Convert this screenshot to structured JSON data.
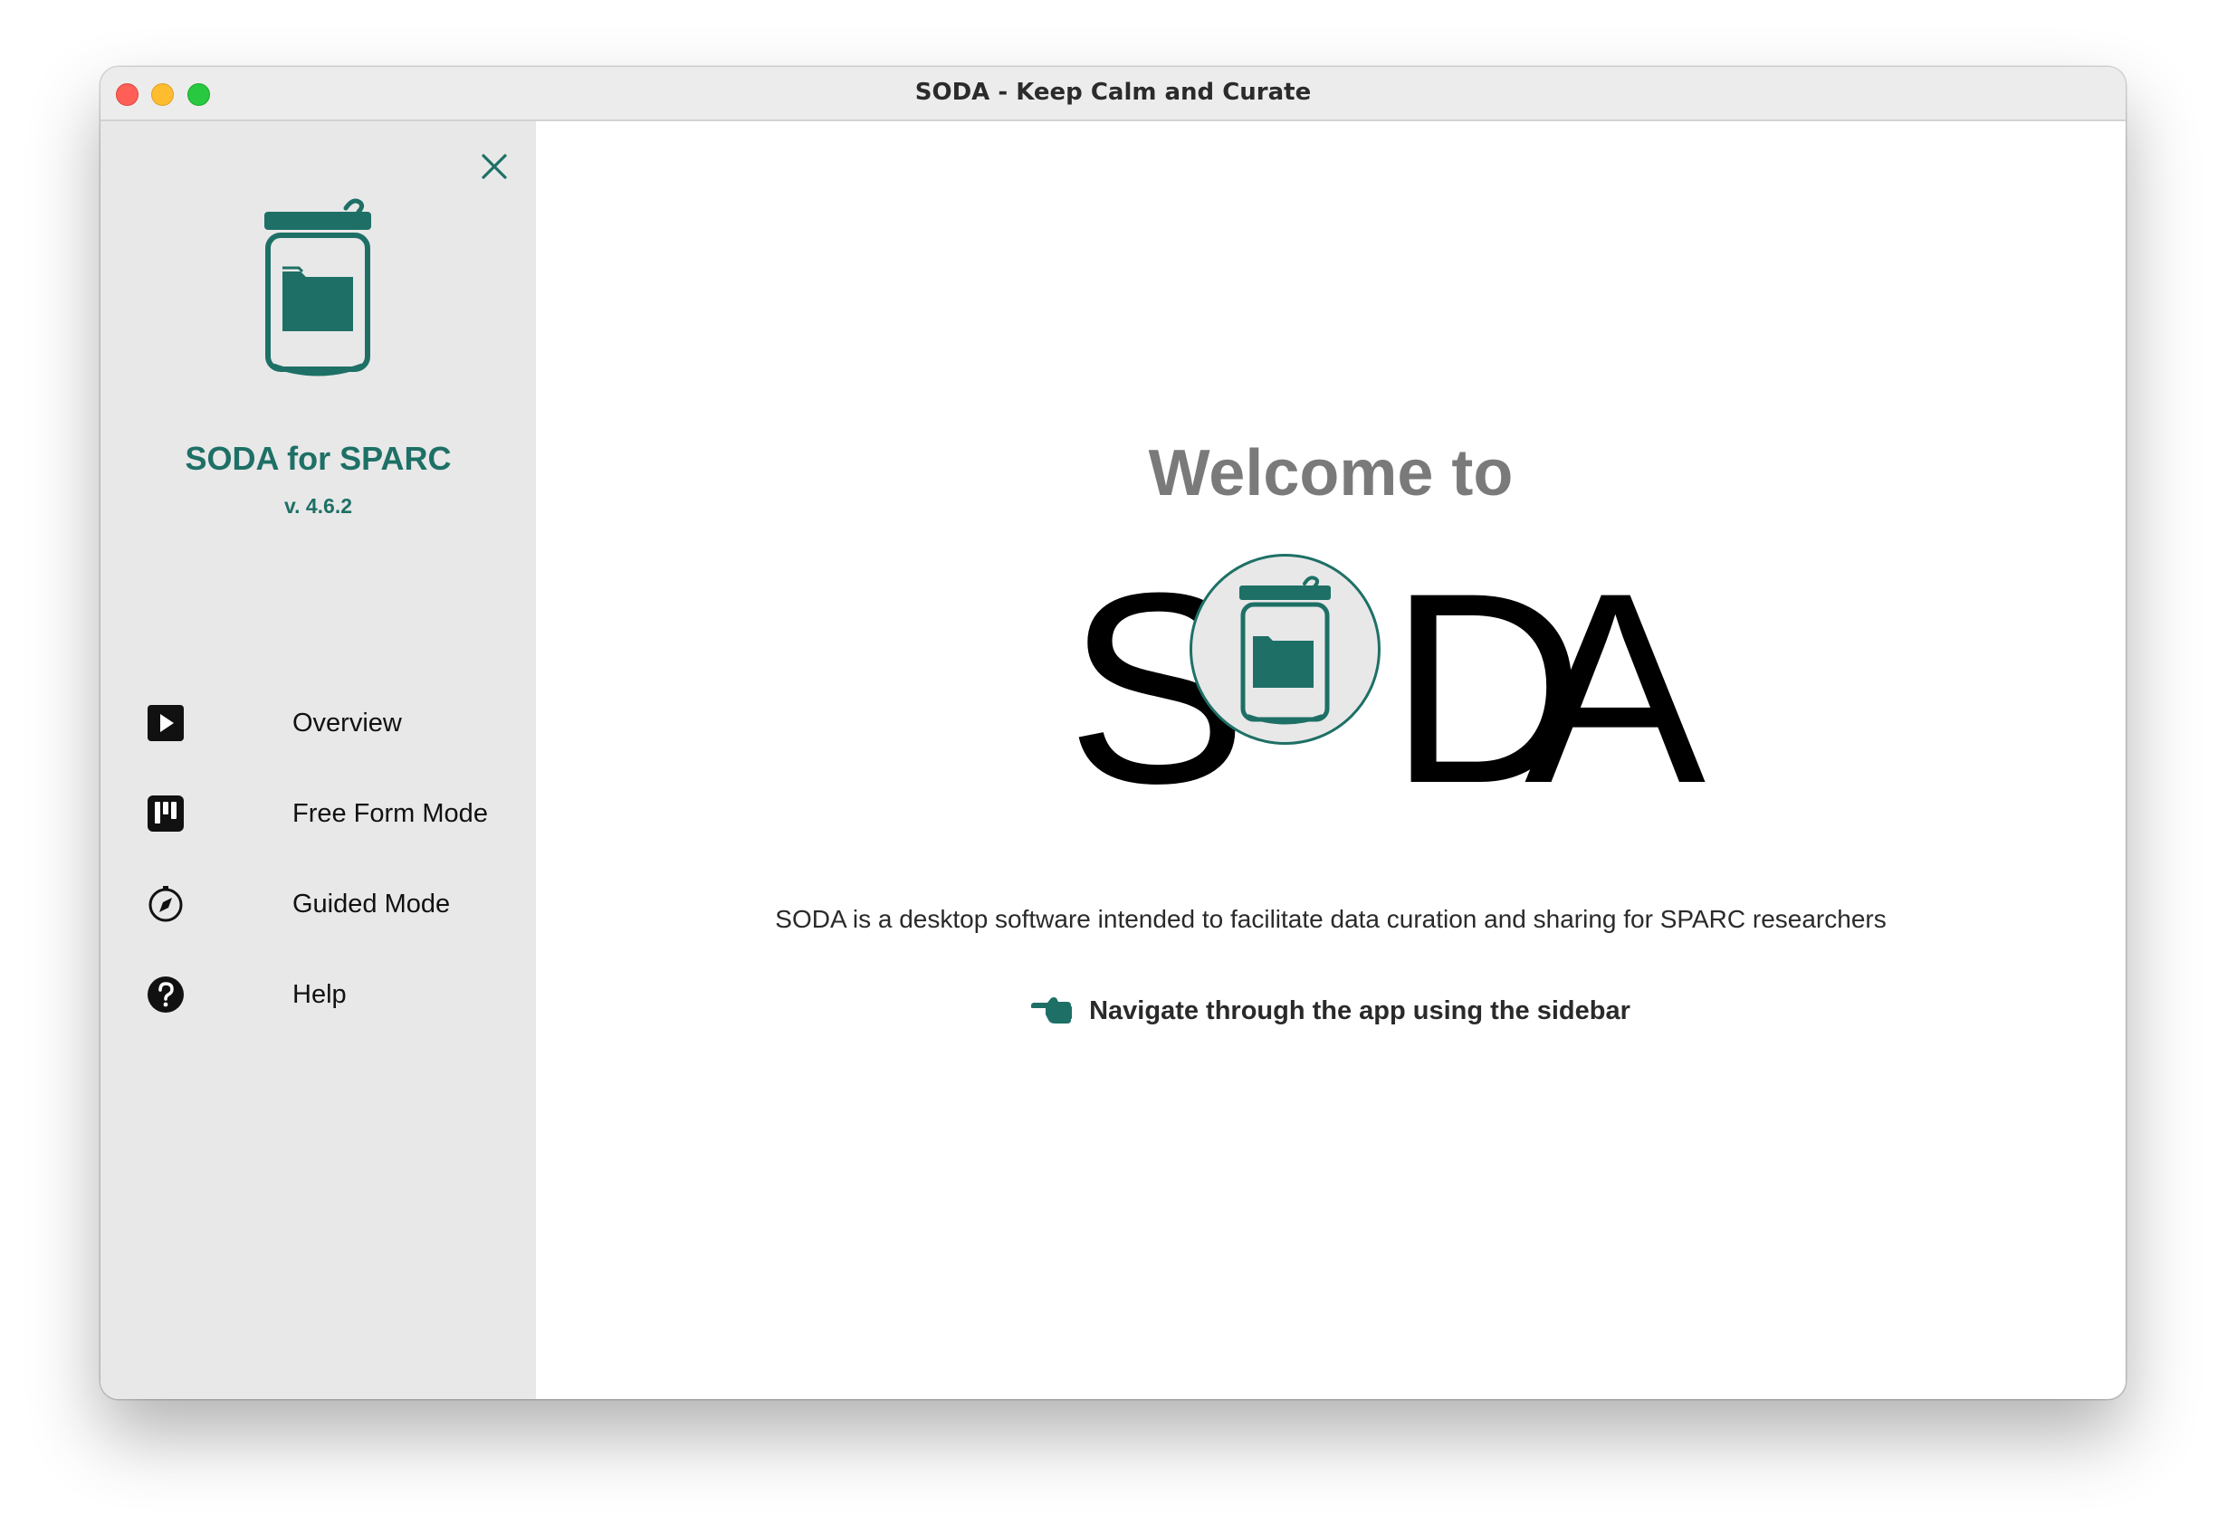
{
  "window": {
    "title": "SODA - Keep Calm and Curate"
  },
  "sidebar": {
    "app_name": "SODA for SPARC",
    "version": "v. 4.6.2",
    "close_icon": "close-icon",
    "items": [
      {
        "label": "Overview",
        "icon": "play-square-icon"
      },
      {
        "label": "Free Form Mode",
        "icon": "kanban-board-icon"
      },
      {
        "label": "Guided Mode",
        "icon": "compass-icon"
      },
      {
        "label": "Help",
        "icon": "question-circle-icon"
      }
    ]
  },
  "main": {
    "welcome": "Welcome to",
    "brand": {
      "s": "S",
      "d": "D",
      "a": "A",
      "o_icon": "soda-can-logo-icon"
    },
    "description": "SODA is a desktop software intended to facilitate data curation and sharing for SPARC researchers",
    "hint": {
      "icon": "pointing-hand-icon",
      "text": "Navigate through the app using the sidebar"
    }
  },
  "colors": {
    "accent": "#1e7066",
    "sidebar_bg": "#e8e8e8",
    "welcome_text": "#7a7a7a"
  }
}
